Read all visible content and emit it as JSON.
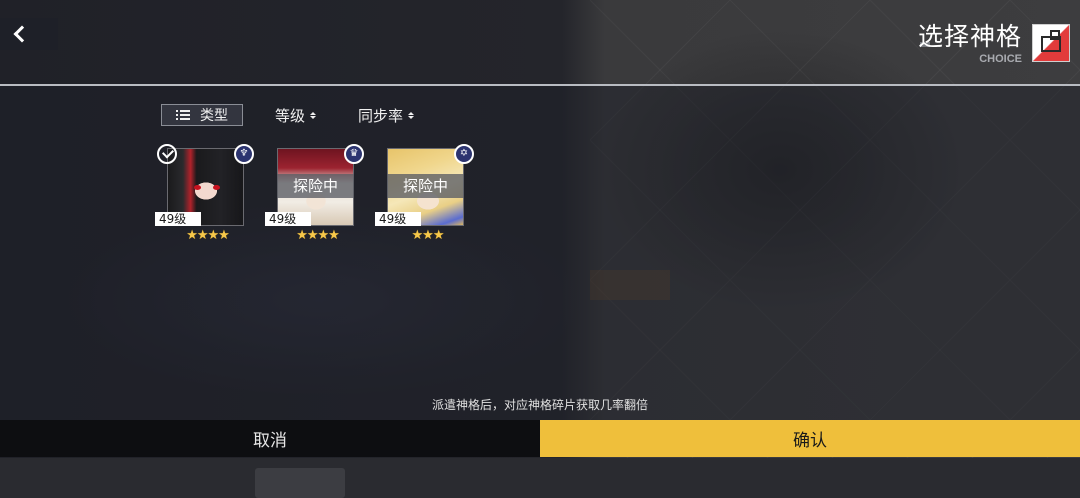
{
  "header": {
    "title": "选择神格",
    "subtitle": "CHOICE"
  },
  "filters": {
    "type_label": "类型",
    "level_label": "等级",
    "sync_label": "同步率"
  },
  "cards": [
    {
      "level": "49级",
      "stars": "★★★★",
      "status": "",
      "selected": true,
      "class_icon": "crest-icon"
    },
    {
      "level": "49级",
      "stars": "★★★★",
      "status": "探险中",
      "selected": false,
      "class_icon": "trophy-icon"
    },
    {
      "level": "49级",
      "stars": "★★★",
      "status": "探险中",
      "selected": false,
      "class_icon": "star-emblem-icon"
    }
  ],
  "footer": {
    "hint": "派遣神格后，对应神格碎片获取几率翻倍",
    "cancel_label": "取消",
    "confirm_label": "确认"
  },
  "colors": {
    "confirm": "#efbf3b",
    "cancel": "#0d0e11",
    "stars": "#f7c84a"
  }
}
